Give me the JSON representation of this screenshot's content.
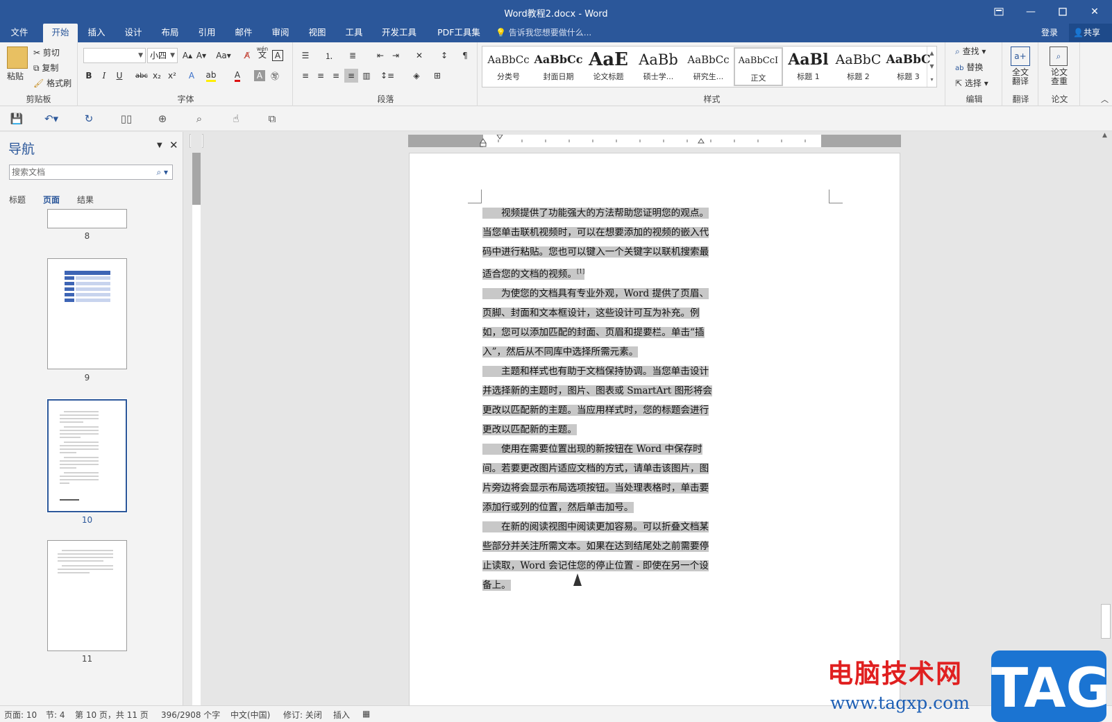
{
  "window": {
    "title": "Word教程2.docx - Word"
  },
  "ribbon_tabs": [
    "文件",
    "开始",
    "插入",
    "设计",
    "布局",
    "引用",
    "邮件",
    "审阅",
    "视图",
    "工具",
    "开发工具",
    "PDF工具集"
  ],
  "tell_me": "告诉我您想要做什么...",
  "account": {
    "login": "登录",
    "share": "共享"
  },
  "clipboard": {
    "paste": "粘贴",
    "cut": "剪切",
    "copy": "复制",
    "format_painter": "格式刷",
    "label": "剪贴板"
  },
  "font": {
    "name": "",
    "size": "小四",
    "label": "字体",
    "case": "Aa",
    "wen": "wén"
  },
  "paragraph": {
    "label": "段落"
  },
  "styles": {
    "label": "样式",
    "items": [
      {
        "preview": "AaBbCc",
        "name": "分类号"
      },
      {
        "preview": "AaBbCc",
        "name": "封面日期"
      },
      {
        "preview": "AaE",
        "name": "论文标题"
      },
      {
        "preview": "AaBb",
        "name": "硕士学..."
      },
      {
        "preview": "AaBbCc",
        "name": "研究生..."
      },
      {
        "preview": "AaBbCcI",
        "name": "正文"
      },
      {
        "preview": "AaBl",
        "name": "标题 1"
      },
      {
        "preview": "AaBbC",
        "name": "标题 2"
      },
      {
        "preview": "AaBbC",
        "name": "标题 3"
      }
    ]
  },
  "editing": {
    "find": "查找",
    "replace": "替换",
    "select": "选择",
    "label": "编辑"
  },
  "translate": {
    "full": "全文翻译",
    "label": "翻译"
  },
  "thesis": {
    "check": "论文查重",
    "label": "论文"
  },
  "nav": {
    "title": "导航",
    "search_placeholder": "搜索文档",
    "tabs": [
      "标题",
      "页面",
      "结果"
    ],
    "pages": [
      "8",
      "9",
      "10",
      "11"
    ]
  },
  "ruler_box": "L",
  "document": {
    "paragraphs": [
      "视频提供了功能强大的方法帮助您证明您的观点。当您单击联机视频时，可以在想要添加的视频的嵌入代码中进行粘贴。您也可以键入一个关键字以联机搜索最适合您的文档的视频。",
      "为使您的文档具有专业外观，Word 提供了页眉、页脚、封面和文本框设计，这些设计可互为补充。例如，您可以添加匹配的封面、页眉和提要栏。单击“插入”，然后从不同库中选择所需元素。",
      "主题和样式也有助于文档保持协调。当您单击设计并选择新的主题时，图片、图表或 SmartArt 图形将会更改以匹配新的主题。当应用样式时，您的标题会进行更改以匹配新的主题。",
      "使用在需要位置出现的新按钮在 Word 中保存时间。若要更改图片适应文档的方式，请单击该图片，图片旁边将会显示布局选项按钮。当处理表格时，单击要添加行或列的位置，然后单击加号。",
      "在新的阅读视图中阅读更加容易。可以折叠文档某些部分并关注所需文本。如果在达到结尾处之前需要停止读取，Word 会记住您的停止位置 - 即使在另一个设备上。"
    ],
    "footnote_ref": "[1]"
  },
  "statusbar": {
    "page": "页面: 10",
    "section": "节: 4",
    "page_of": "第 10 页，共 11 页",
    "words": "396/2908 个字",
    "lang": "中文(中国)",
    "track": "修订: 关闭",
    "insert": "插入"
  },
  "watermark": {
    "cn": "电脑技术网",
    "url": "www.tagxp.com",
    "tag": "TAG"
  },
  "colors": {
    "brand": "#2b579a",
    "selection": "#c8c8c8"
  }
}
